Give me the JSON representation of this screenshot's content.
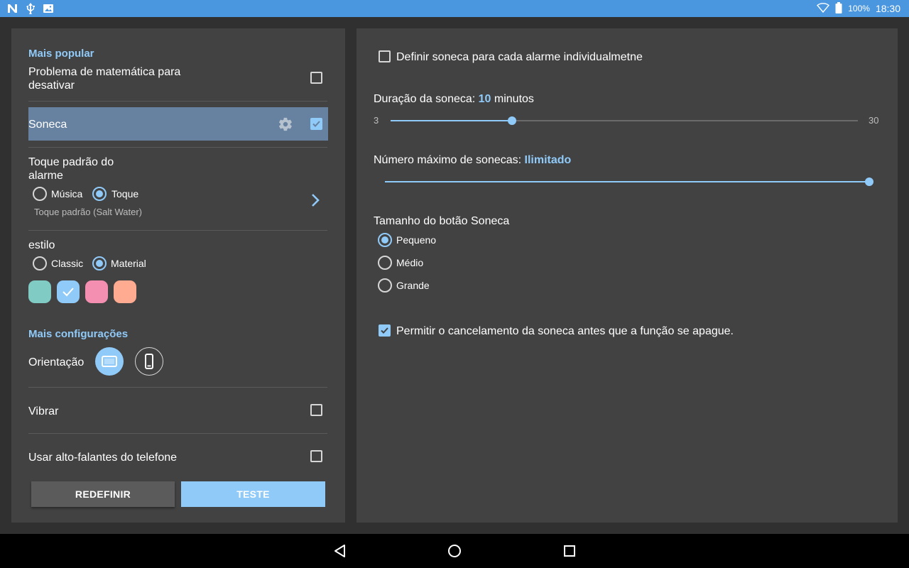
{
  "status_bar": {
    "icons_left": [
      "n-logo-icon",
      "usb-icon",
      "image-icon"
    ],
    "battery_percent": "100%",
    "time": "18:30"
  },
  "left_panel": {
    "popular_header": "Mais popular",
    "math_problem_label": "Problema de matemática para desativar",
    "math_problem_line1": "Problema de matemática para",
    "math_problem_line2": "desativar",
    "math_problem_checked": false,
    "snooze_label": "Soneca",
    "snooze_checked": true,
    "ringtone_line1": "Toque padrão do",
    "ringtone_line2": "alarme",
    "ringtone_options": [
      "Música",
      "Toque"
    ],
    "ringtone_selected": "Toque",
    "ringtone_current": "Toque padrão (Salt Water)",
    "style_label": "estilo",
    "style_options": [
      "Classic",
      "Material"
    ],
    "style_selected": "Material",
    "color_swatches": [
      "#80cbc4",
      "#90caf9",
      "#f48fb1",
      "#ffab91"
    ],
    "color_selected": "#90caf9",
    "more_settings_header": "Mais configurações",
    "orientation_label": "Orientação",
    "orientation_selected": "landscape",
    "vibrate_label": "Vibrar",
    "vibrate_checked": false,
    "speakers_label": "Usar alto-falantes do telefone",
    "speakers_checked": false,
    "reset_button": "REDEFINIR",
    "test_button": "TESTE"
  },
  "right_panel": {
    "individual_snooze_label": "Definir soneca para cada alarme individualmetne",
    "individual_snooze_checked": false,
    "duration_prefix": "Duração da soneca: ",
    "duration_value": "10",
    "duration_suffix": " minutos",
    "duration_min": "3",
    "duration_max": "30",
    "duration_slider_value": 10,
    "max_snoozes_prefix": "Número máximo de sonecas: ",
    "max_snoozes_value": "Ilimitado",
    "max_snoozes_slider_fraction": 1.0,
    "button_size_label": "Tamanho do botão Soneca",
    "button_size_options": [
      "Pequeno",
      "Médio",
      "Grande"
    ],
    "button_size_selected": "Pequeno",
    "allow_cancel_label": "Permitir o cancelamento da soneca antes que a função se apague.",
    "allow_cancel_checked": true
  },
  "colors": {
    "accent": "#90caf9",
    "status_bar": "#4a97e0",
    "panel": "#424242",
    "background": "#303030"
  }
}
